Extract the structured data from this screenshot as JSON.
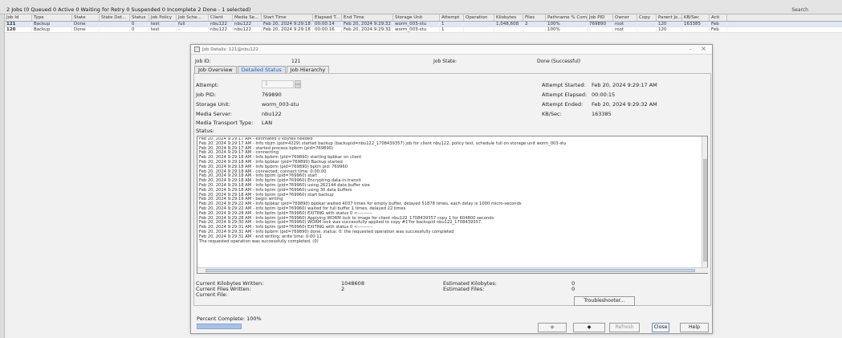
{
  "jobs_bar": {
    "summary": "2 Jobs (0 Queued 0 Active 0 Waiting for Retry 0 Suspended 0 Incomplete 2 Done - 1 selected)",
    "search_label": "Search"
  },
  "table": {
    "columns": [
      "Job Id",
      "Type",
      "State",
      "State Det...",
      "Status",
      "Job Policy",
      "Job Sche...",
      "Client",
      "Media Se...",
      "Start Time",
      "Elapsed T...",
      "End Time",
      "Storage Unit",
      "Attempt",
      "Operation",
      "Kilobytes",
      "Files",
      "Pathname % Comple...",
      "Job PID",
      "Owner",
      "Copy",
      "Parent Jo...",
      "KB/Sec",
      "Acti"
    ],
    "rows": [
      [
        "121",
        "Backup",
        "Done",
        "",
        "0",
        "test",
        "full",
        "nbu122",
        "nbu122",
        "Feb 20, 2024 9:29:18 AM",
        "00:00:14",
        "Feb 20, 2024 9:29:32 AM",
        "worm_003-stu",
        "1",
        "",
        "1,048,608",
        "2",
        "100%",
        "769890",
        "root",
        "",
        "120",
        "163385",
        "Feb"
      ],
      [
        "120",
        "Backup",
        "Done",
        "",
        "0",
        "test",
        "-",
        "nbu122",
        "nbu122",
        "Feb 20, 2024 9:29:18 AM",
        "00:00:16",
        "Feb 20, 2024 9:29:32 AM",
        "worm_003-stu",
        "1",
        "",
        "",
        "",
        "100%",
        "",
        "root",
        "",
        "120",
        "",
        "Feb"
      ]
    ]
  },
  "dialog": {
    "title": "Job Details: 121@nbu122",
    "job_id_label": "Job ID:",
    "job_id": "121",
    "job_state_label": "Job State:",
    "job_state": "Done (Successful)",
    "tabs": [
      "Job Overview",
      "Detailed Status",
      "Job Hierarchy"
    ],
    "attempt_label": "Attempt:",
    "attempt": "1",
    "job_pid_label": "Job PID:",
    "job_pid": "769890",
    "storage_unit_label": "Storage Unit:",
    "storage_unit": "worm_003-stu",
    "media_server_label": "Media Server:",
    "media_server": "nbu122",
    "transport_label": "Media Transport Type:",
    "transport": "LAN",
    "status_label": "Status:",
    "attempt_started_label": "Attempt Started:",
    "attempt_started": "Feb 20, 2024 9:29:17 AM",
    "attempt_elapsed_label": "Attempt Elapsed:",
    "attempt_elapsed": "00:00:15",
    "attempt_ended_label": "Attempt Ended:",
    "attempt_ended": "Feb 20, 2024 9:29:32 AM",
    "kbsec_label": "KB/Sec:",
    "kbsec": "163385",
    "log": [
      "Feb 20, 2024 9:29:17 AM - estimated 0 kbytes needed",
      "Feb 20, 2024 9:29:17 AM - Info nbjm (pid=4229) started backup (backupid=nbu122_1708439357) job for client nbu122, policy test, schedule full on storage unit worm_003-stu",
      "Feb 20, 2024 9:29:17 AM - started process bpbrm (pid=769890)",
      "Feb 20, 2024 9:29:17 AM - connecting",
      "Feb 20, 2024 9:29:18 AM - Info bpbrm (pid=769890) starting bpbkar on client",
      "Feb 20, 2024 9:29:18 AM - Info bpbkar (pid=769890) Backup started",
      "Feb 20, 2024 9:29:18 AM - Info bpbrm (pid=769890) bptm pid: 769960",
      "Feb 20, 2024 9:29:18 AM - connected; connect time: 0:00:00",
      "Feb 20, 2024 9:29:18 AM - Info bptm (pid=769960) start",
      "Feb 20, 2024 9:29:18 AM - Info bptm (pid=769960) Encrypting data-in-transit",
      "Feb 20, 2024 9:29:18 AM - Info bptm (pid=769960) using 262144 data buffer size",
      "Feb 20, 2024 9:29:18 AM - Info bptm (pid=769960) using 30 data buffers",
      "Feb 20, 2024 9:29:18 AM - Info bptm (pid=769960) start backup",
      "Feb 20, 2024 9:29:19 AM - begin writing",
      "Feb 20, 2024 9:29:22 AM - Info bpbkar (pid=769890) bpbkar waited 4037 times for empty buffer, delayed 51878 times, each delay is 1000 micro-seconds",
      "Feb 20, 2024 9:29:22 AM - Info bptm (pid=769960) waited for full buffer 1 times, delayed 22 times",
      "Feb 20, 2024 9:29:28 AM - Info bptm (pid=769960) EXITING with status 0 <----------",
      "Feb 20, 2024 9:29:28 AM - Info bptm (pid=769960) Applying WORM lock to image for client nbu122_1708439357 copy 1 for 604800 seconds",
      "Feb 20, 2024 9:29:30 AM - Info bptm (pid=769960) WORM lock was successfully applied to copy #1 for backupid nbu122_1708439357.",
      "Feb 20, 2024 9:29:31 AM - Info bptm (pid=769960) EXITING with status 0 <----------",
      "Feb 20, 2024 9:29:31 AM - Info bpbrm (pid=769890) done. status: 0: the requested operation was successfully completed",
      "Feb 20, 2024 9:29:31 AM - end writing; write time: 0:00:11",
      "The requested operation was successfully completed.  (0)"
    ],
    "current_kb_label": "Current Kilobytes Written:",
    "current_kb": "1048608",
    "current_files_label": "Current Files Written:",
    "current_files": "2",
    "current_file_label": "Current File:",
    "current_file": "",
    "estimated_kb_label": "Estimated Kilobytes:",
    "estimated_kb": "0",
    "estimated_files_label": "Estimated Files:",
    "estimated_files": "0",
    "troubleshooter_label": "Troubleshooter...",
    "percent_label": "Percent Complete: 100%",
    "percent_value": 1.0,
    "buttons": {
      "prev": "◆",
      "next": "◆",
      "refresh": "Refresh",
      "close": "Close",
      "help": "Help"
    }
  }
}
